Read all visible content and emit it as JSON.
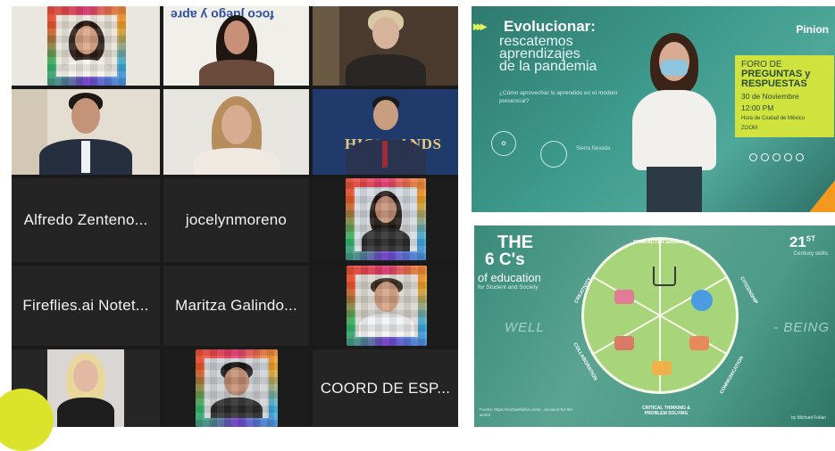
{
  "participants": {
    "names": [
      "Alfredo Zenteno...",
      "jocelynmoreno",
      "Fireflies.ai Notet...",
      "Maritza Galindo...",
      "COORD DE ESP..."
    ],
    "wall_text": "foco juego y apre",
    "backdrop_text": "HIGHLANDS"
  },
  "slide_event": {
    "title": "Evolucionar:",
    "subtitle_lines": [
      "rescatemos",
      "aprendizajes",
      "de la pandemia"
    ],
    "question": "¿Cómo aprovechar lo aprendido en el modelo presencial?",
    "brand": "Pinion",
    "panel": {
      "line1": "FORO DE",
      "line2": "PREGUNTAS y",
      "line3": "RESPUESTAS",
      "date": "30 de Noviembre",
      "time": "12:00 PM",
      "tz": "Hora de Ciudad de México",
      "platform": "ZOOM"
    },
    "logo_label": "Sierra Nevada"
  },
  "slide_6cs": {
    "the": "THE",
    "six_cs": "6 C's",
    "of_education": "of education",
    "for_students": "for Student and Society",
    "century_num": "21",
    "century_sup": "ST",
    "century_skills": "Century skills",
    "well": "WELL",
    "being": "- BEING",
    "segments": [
      "CHARACTER Education",
      "CITIZENSHIP",
      "COMMUNICATION",
      "CRITICAL THINKING & PROBLEM SOLVING",
      "COLLABORATION",
      "CREATIVITY"
    ],
    "footer_source": "Fuente: https://michaelfullan.ca/ne...ducation-for-the-world/",
    "footer_author": "by Michael Fullan"
  },
  "colors": {
    "active_border": "#c7e06a",
    "panel_yellow": "#cfe23e",
    "accent_orange": "#f39a1e",
    "corner_yellow": "#dbe42a"
  }
}
